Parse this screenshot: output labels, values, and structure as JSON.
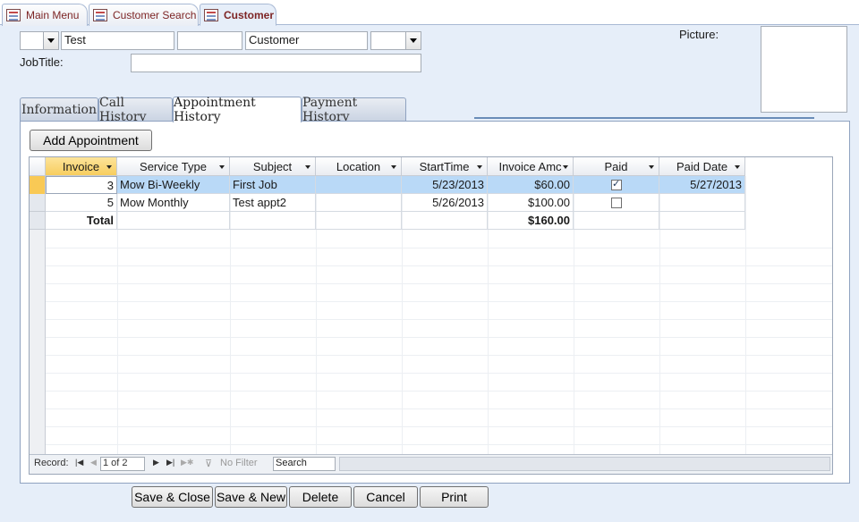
{
  "doc_tabs": [
    {
      "label": "Main Menu"
    },
    {
      "label": "Customer Search"
    },
    {
      "label": "Customer"
    }
  ],
  "header": {
    "title_value": "",
    "first_name": "Test",
    "middle_name": "",
    "last_name": "Customer",
    "suffix_value": "",
    "jobtitle_label": "JobTitle:",
    "jobtitle_value": "",
    "picture_label": "Picture:"
  },
  "form_tabs": [
    {
      "label": "Information"
    },
    {
      "label": "Call History"
    },
    {
      "label": "Appointment History"
    },
    {
      "label": "Payment History"
    }
  ],
  "add_button": "Add Appointment",
  "grid": {
    "columns": [
      "Invoice",
      "Service Type",
      "Subject",
      "Location",
      "StartTime",
      "Invoice Amc",
      "Paid",
      "Paid Date"
    ],
    "rows": [
      {
        "invoice": "3",
        "service_type": "Mow Bi-Weekly",
        "subject": "First Job",
        "location": "",
        "start": "5/23/2013",
        "amount": "$60.00",
        "paid": true,
        "paid_date": "5/27/2013"
      },
      {
        "invoice": "5",
        "service_type": "Mow Monthly",
        "subject": "Test appt2",
        "location": "",
        "start": "5/26/2013",
        "amount": "$100.00",
        "paid": false,
        "paid_date": ""
      }
    ],
    "total_label": "Total",
    "total_amount": "$160.00"
  },
  "nav": {
    "record_label": "Record:",
    "position": "1 of 2",
    "filter_label": "No Filter",
    "search_placeholder": "Search"
  },
  "footer_buttons": {
    "save_close": "Save & Close",
    "save_new": "Save & New",
    "delete": "Delete",
    "cancel": "Cancel",
    "print": "Print"
  },
  "colors": {
    "background": "#e6eef9",
    "selected_row": "#b9d9f7",
    "selected_header": "#f7cd5e",
    "tab_text": "#7d2525"
  }
}
